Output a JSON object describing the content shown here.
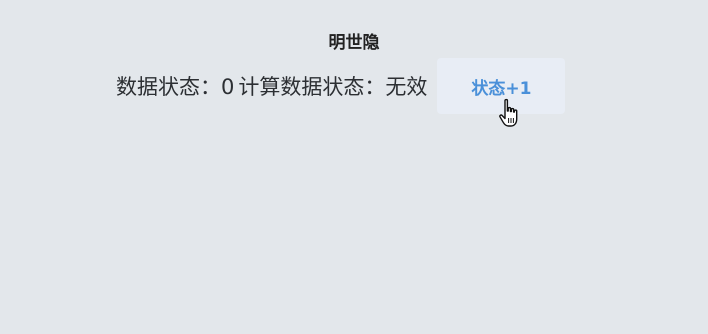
{
  "header": {
    "title": "明世隐"
  },
  "status": {
    "data_state_label": "数据状态：",
    "data_state_value": "0",
    "computed_state_label": "计算数据状态：",
    "computed_state_value": "无效"
  },
  "actions": {
    "increment_label": "状态+1"
  },
  "pointer": {
    "icon": "hand-pointer-icon"
  },
  "colors": {
    "background": "#e3e7eb",
    "button_background": "#e8edf5",
    "button_text": "#4a90d9"
  }
}
